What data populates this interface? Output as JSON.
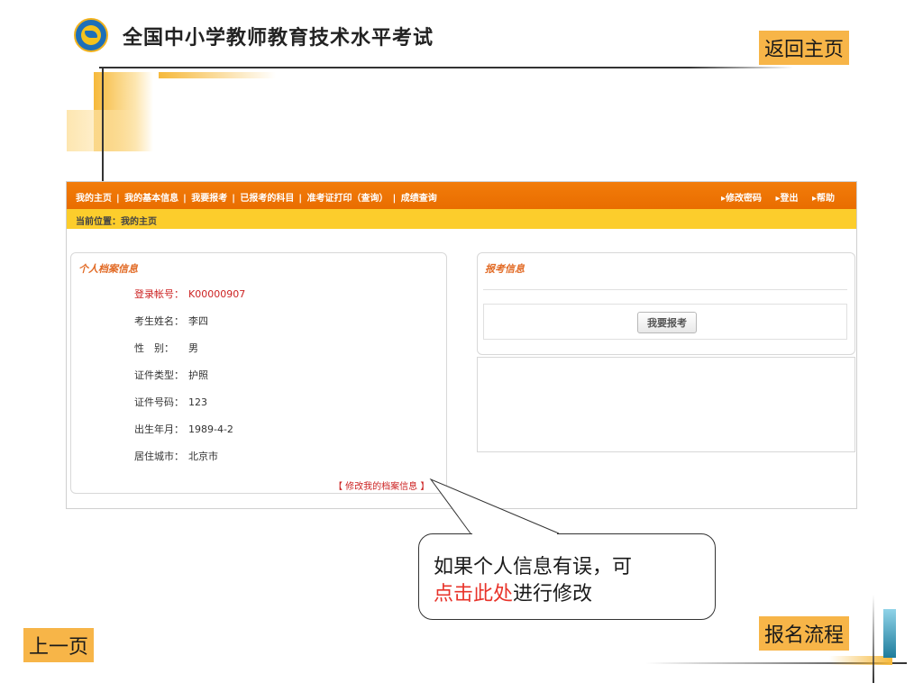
{
  "slide": {
    "site_title": "全国中小学教师教育技术水平考试",
    "btn_home": "返回主页",
    "btn_prev": "上一页",
    "btn_flow": "报名流程"
  },
  "nav": {
    "items": [
      "我的主页",
      "我的基本信息",
      "我要报考",
      "已报考的科目",
      "准考证打印（查询）",
      "成绩查询"
    ],
    "separator": "|",
    "right_items": [
      "▸修改密码",
      "▸登出",
      "▸帮助"
    ]
  },
  "breadcrumb": "当前位置：我的主页",
  "profile": {
    "title": "个人档案信息",
    "fields": [
      {
        "label": "登录帐号：",
        "value": "K00000907"
      },
      {
        "label": "考生姓名：",
        "value": "李四"
      },
      {
        "label": "性　别：",
        "value": "男"
      },
      {
        "label": "证件类型：",
        "value": "护照"
      },
      {
        "label": "证件号码：",
        "value": "123"
      },
      {
        "label": "出生年月：",
        "value": "1989-4-2"
      },
      {
        "label": "居住城市：",
        "value": "北京市"
      }
    ],
    "edit_link": "【 修改我的档案信息 】"
  },
  "exam": {
    "title": "报考信息",
    "button": "我要报考"
  },
  "callout": {
    "line1": "如果个人信息有误，可",
    "line2_highlight": "点击此处",
    "line2_rest": "进行修改"
  },
  "colors": {
    "nav_orange": "#f27c0a",
    "breadcrumb_yellow": "#fccd2c",
    "button_orange": "#f7b548",
    "highlight_red": "#e8332a"
  }
}
